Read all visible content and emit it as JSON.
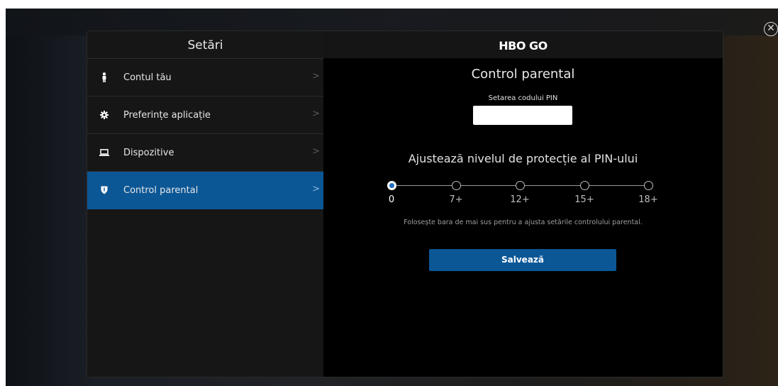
{
  "sidebar": {
    "title": "Setări",
    "items": [
      {
        "label": "Contul tău",
        "icon": "person-icon"
      },
      {
        "label": "Preferințe aplicație",
        "icon": "gear-icon"
      },
      {
        "label": "Dispozitive",
        "icon": "laptop-icon"
      },
      {
        "label": "Control parental",
        "icon": "shield-icon",
        "active": true
      }
    ]
  },
  "header": {
    "logo": "HBO GO"
  },
  "main": {
    "title": "Control parental",
    "pin_label": "Setarea codului PIN",
    "pin_value": "",
    "level_title": "Ajustează nivelul de protecție al PIN-ului",
    "levels": [
      "0",
      "7+",
      "12+",
      "15+",
      "18+"
    ],
    "selected_level": "0",
    "hint": "Folosește bara de mai sus pentru a ajusta setările controlului parental.",
    "save_label": "Salvează"
  },
  "colors": {
    "accent": "#0b5796",
    "background": "#000000",
    "sidebar": "#161616"
  }
}
